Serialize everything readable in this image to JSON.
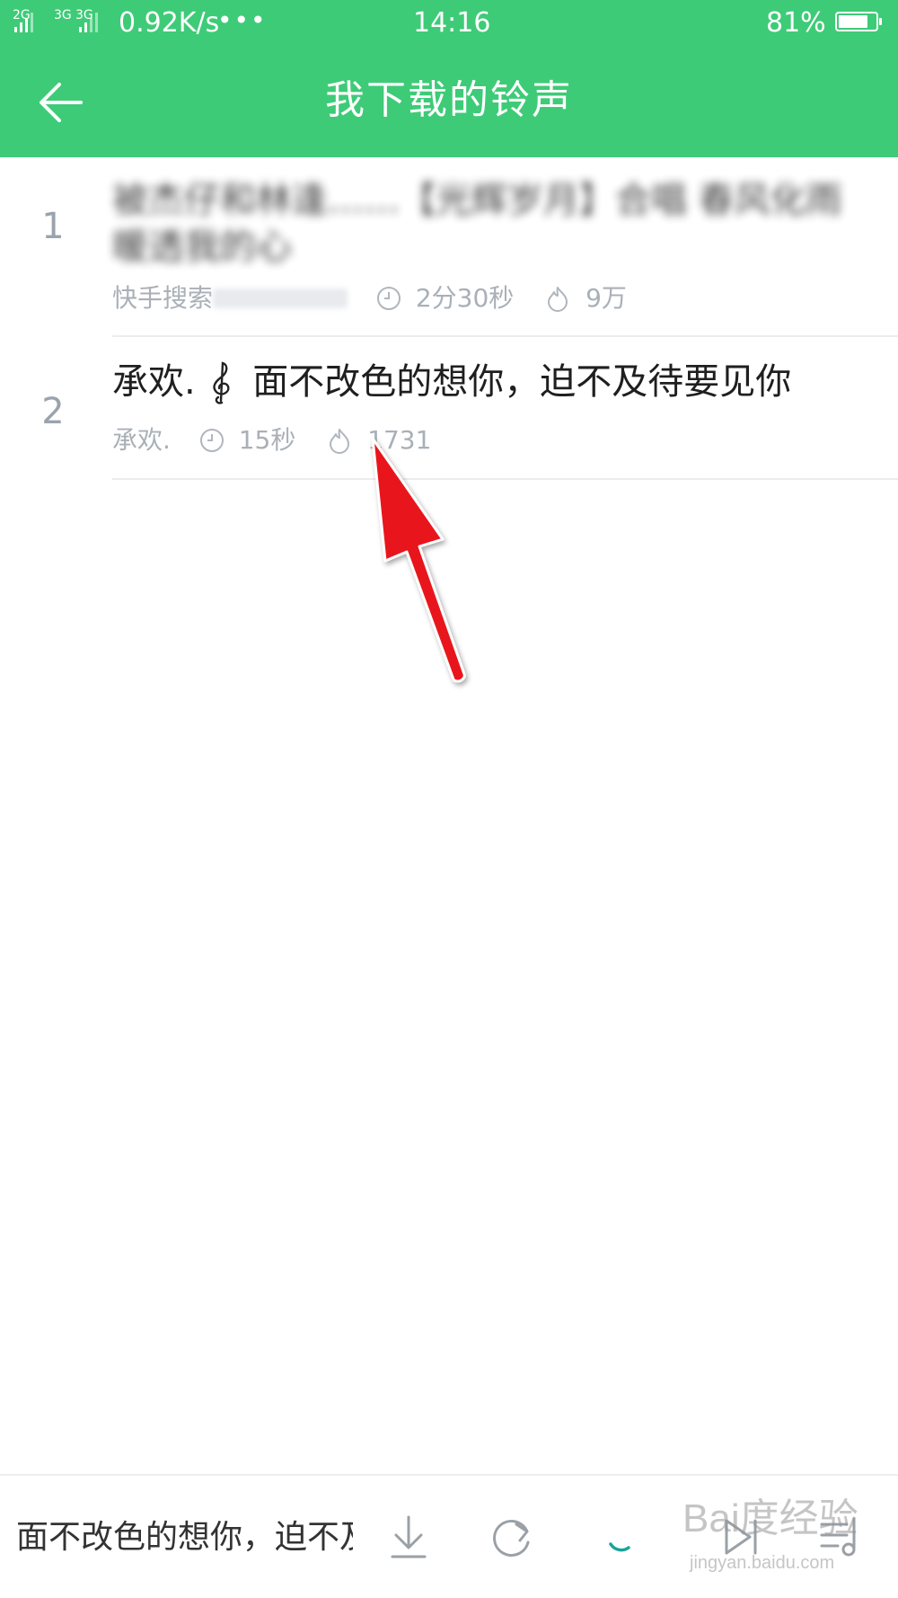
{
  "status_bar": {
    "sim1_type": "2G",
    "sim2_type": "3G",
    "sim2_type_b": "3G",
    "net_speed": "0.92K/s",
    "more": "•••",
    "time": "14:16",
    "battery_percent": "81%",
    "battery_level": 0.81
  },
  "header": {
    "title": "我下载的铃声",
    "back_icon": "arrow-left-icon"
  },
  "ringtones": [
    {
      "index": "1",
      "title": "被杰仔和林逢……【光辉岁月】合唱 春风化雨暖透我的心",
      "source": "快手搜索",
      "duration": "2分30秒",
      "plays": "9万",
      "blurred": true
    },
    {
      "index": "2",
      "title": "承欢.     面不改色的想你，迫不及待要见你",
      "source": "承欢.",
      "duration": "15秒",
      "plays": "1731",
      "blurred": false
    }
  ],
  "player": {
    "now_playing": "面不改色的想你，迫不及待要见你",
    "icons": [
      "download-icon",
      "repeat-icon",
      "loading-icon",
      "next-icon",
      "playlist-icon"
    ]
  },
  "watermark": {
    "text": "Bai度经验",
    "url": "jingyan.baidu.com"
  },
  "colors": {
    "brand": "#3ecb77",
    "annotation": "#e8131a"
  }
}
